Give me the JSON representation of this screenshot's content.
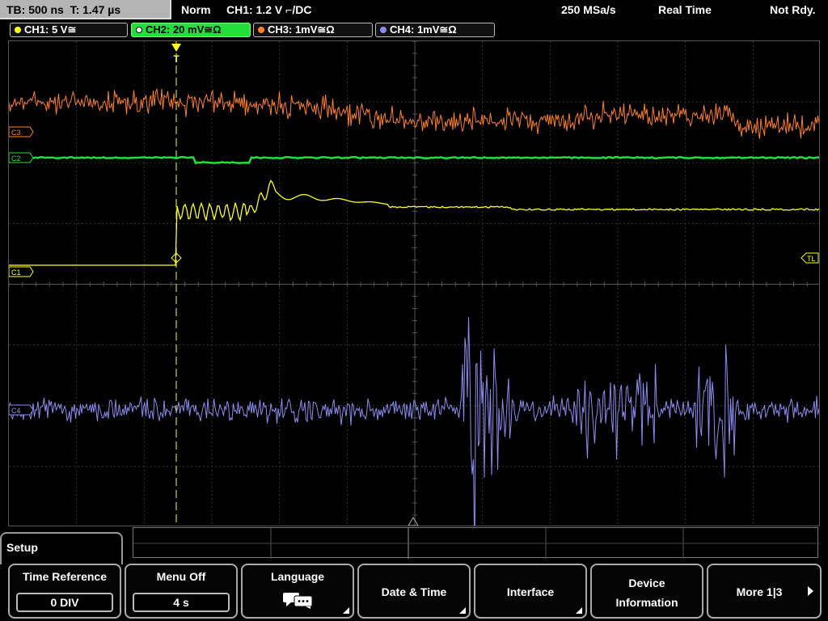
{
  "status_bar": {
    "timebase": "TB: 500 ns",
    "trigger_time": "T: 1.47 µs",
    "mode": "Norm",
    "trigger": "CH1: 1.2 V ⌐/DC",
    "sample_rate": "250 MSa/s",
    "acq_mode": "Real Time",
    "state": "Not Rdy."
  },
  "channels": [
    {
      "label": "CH1: 5 V≅",
      "color": "#ffff1e"
    },
    {
      "label": "CH2: 20 mV≅Ω",
      "color": "#22e03a"
    },
    {
      "label": "CH3: 1mV≅Ω",
      "color": "#ff7f2a"
    },
    {
      "label": "CH4: 1mV≅Ω",
      "color": "#8c8cf0"
    }
  ],
  "markers": {
    "c3": "C3",
    "c2": "C2",
    "c1": "C1",
    "c4": "C4",
    "tl": "TL",
    "trigger": "T"
  },
  "menu": {
    "title": "Setup"
  },
  "softkeys": [
    {
      "label": "Time Reference",
      "value": "0 DIV"
    },
    {
      "label": "Menu Off",
      "value": "4 s"
    },
    {
      "label": "Language",
      "icon": "speech-bubbles-icon"
    },
    {
      "label": "Date & Time"
    },
    {
      "label": "Interface"
    },
    {
      "label_line1": "Device",
      "label_line2": "Information"
    },
    {
      "label": "More 1|3"
    }
  ]
}
